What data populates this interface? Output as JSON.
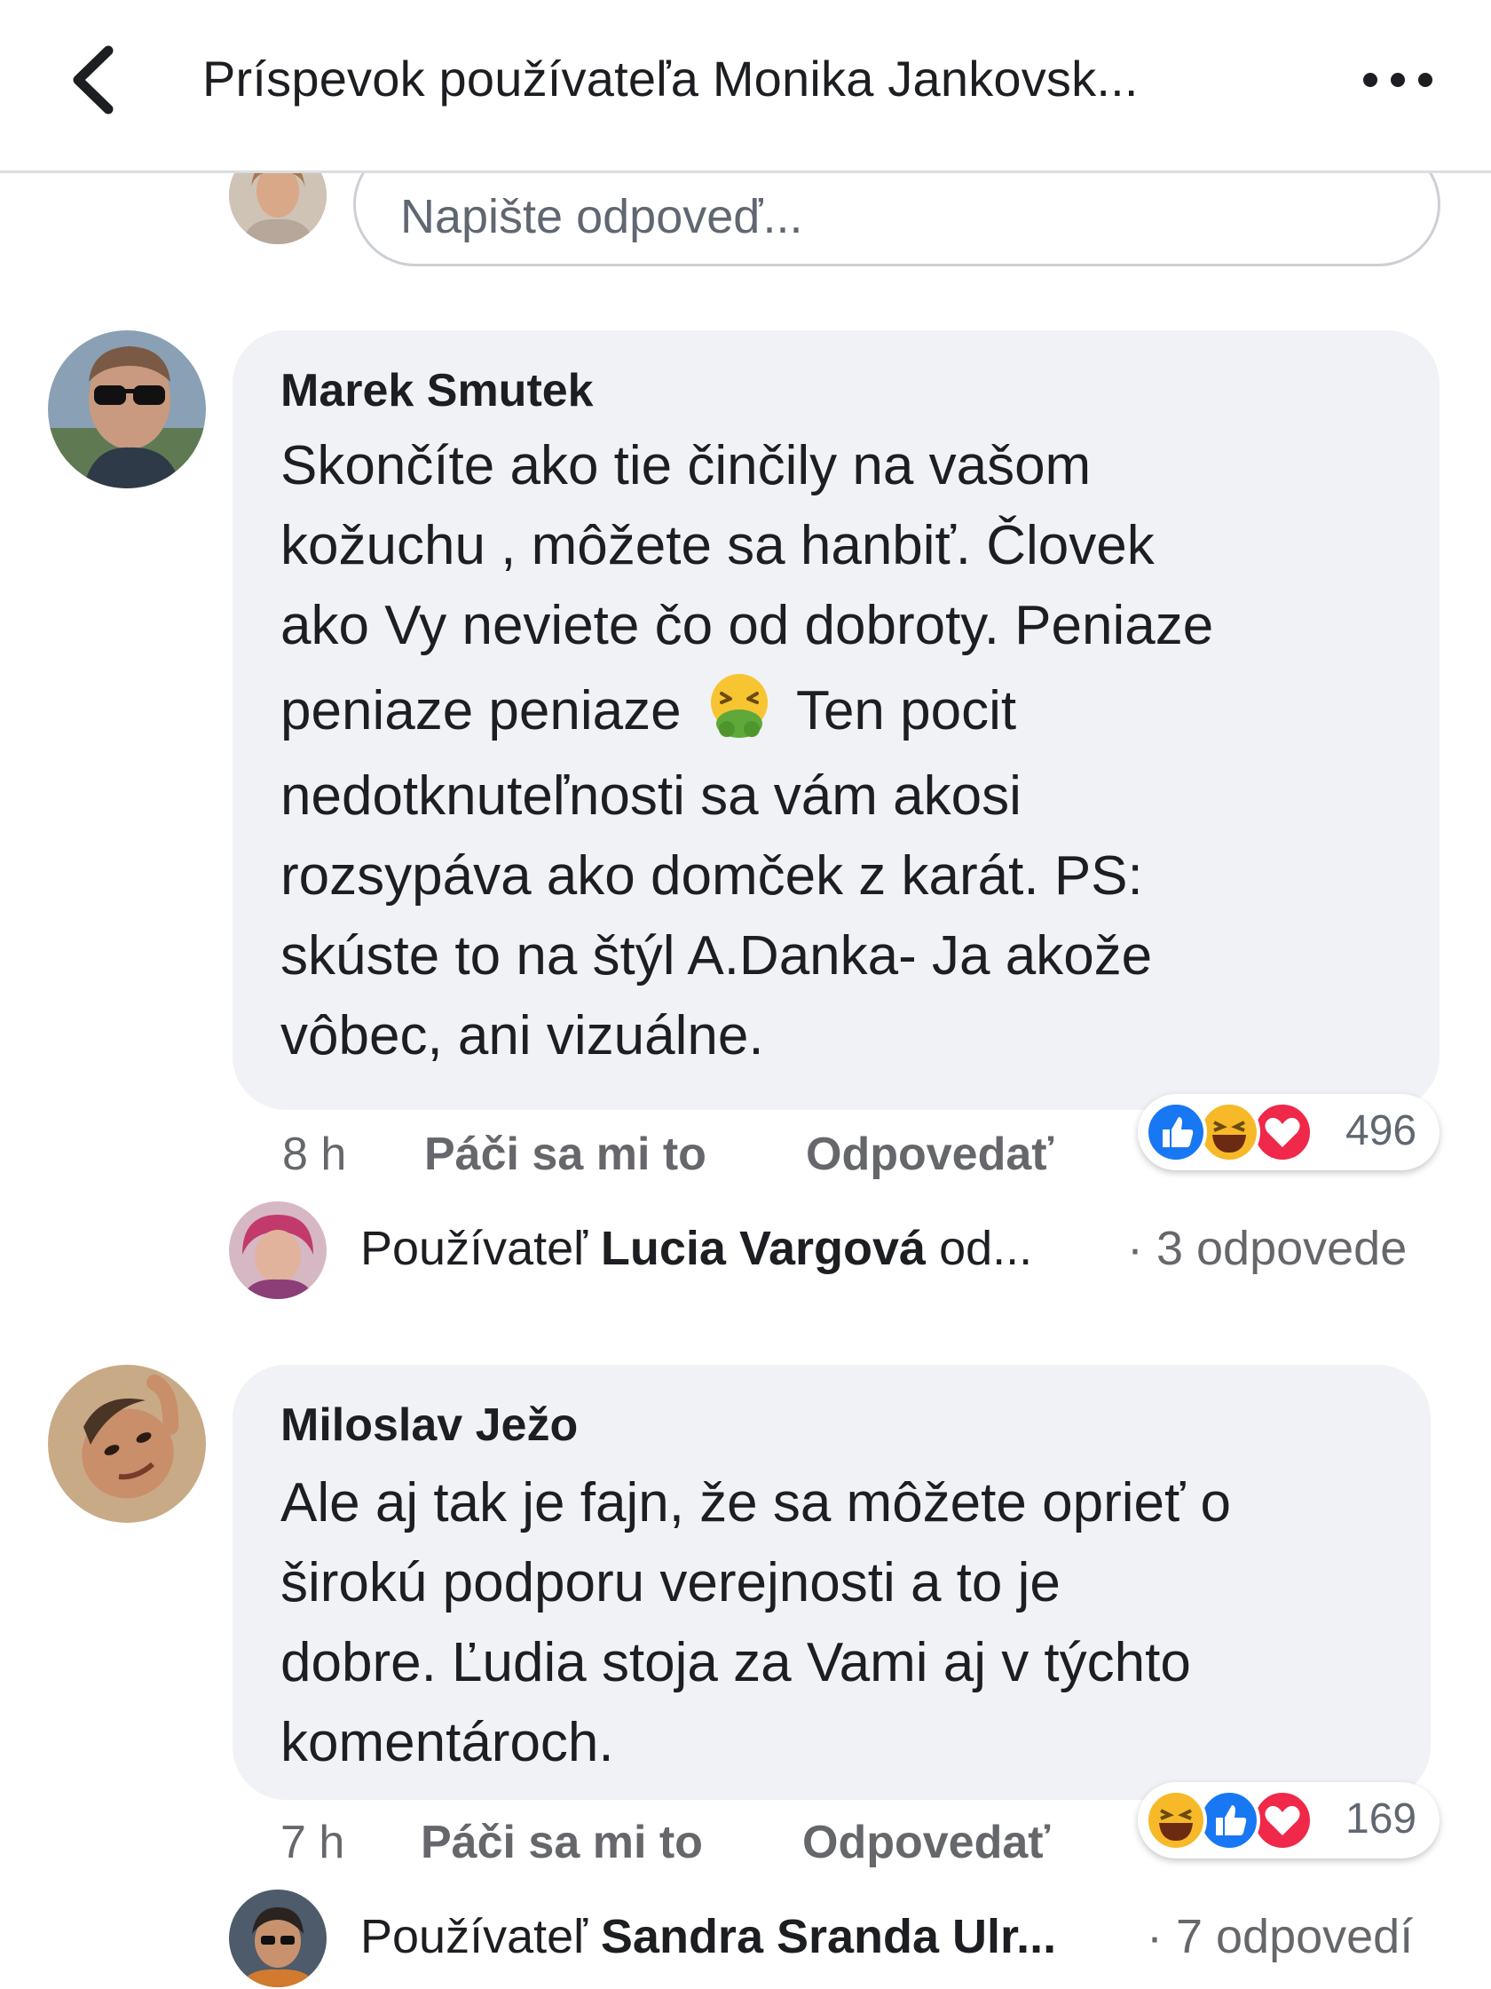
{
  "header": {
    "title": "Príspevok používateľa Monika Jankovsk...",
    "back_icon": "chevron-left-icon",
    "more_icon": "more-horizontal-icon"
  },
  "composer": {
    "placeholder": "Napište odpoveď..."
  },
  "comments": [
    {
      "author": "Marek Smutek",
      "text_lines": [
        "Skončíte ako tie činčily na vašom",
        "kožuchu , môžete sa hanbiť. Človek",
        "ako Vy neviete čo od dobroty.  Peniaze",
        "peniaze peniaze",
        "Ten pocit",
        "nedotknuteľnosti sa vám akosi",
        "rozsypáva ako domček z karát. PS:",
        "skúste to na štýl A.Danka- Ja akože",
        "vôbec, ani vizuálne."
      ],
      "emoji": "vomiting-face-icon",
      "time": "8 h",
      "like_label": "Páči sa mi to",
      "reply_label": "Odpovedať",
      "reactions": [
        "like",
        "haha",
        "love"
      ],
      "reaction_count": "496",
      "replies": {
        "prefix": "Používateľ ",
        "name": "Lucia Vargová",
        "suffix": " od...",
        "count": "· 3 odpovede"
      }
    },
    {
      "author": "Miloslav Ježo",
      "text_lines": [
        "Ale aj tak je fajn, že sa môžete oprieť o",
        "širokú podporu verejnosti a to je",
        "dobre. Ľudia stoja za Vami aj v týchto",
        "komentároch."
      ],
      "time": "7 h",
      "like_label": "Páči sa mi to",
      "reply_label": "Odpovedať",
      "reactions": [
        "haha",
        "like",
        "love"
      ],
      "reaction_count": "169",
      "replies": {
        "prefix": "Používateľ ",
        "name": "Sandra Sranda Ulr...",
        "suffix": "",
        "count": "· 7 odpovedí"
      }
    }
  ],
  "colors": {
    "bubble": "#f0f2f5",
    "meta": "#65676b",
    "like": "#1877f2",
    "love": "#f02849",
    "haha": "#f7b928"
  }
}
